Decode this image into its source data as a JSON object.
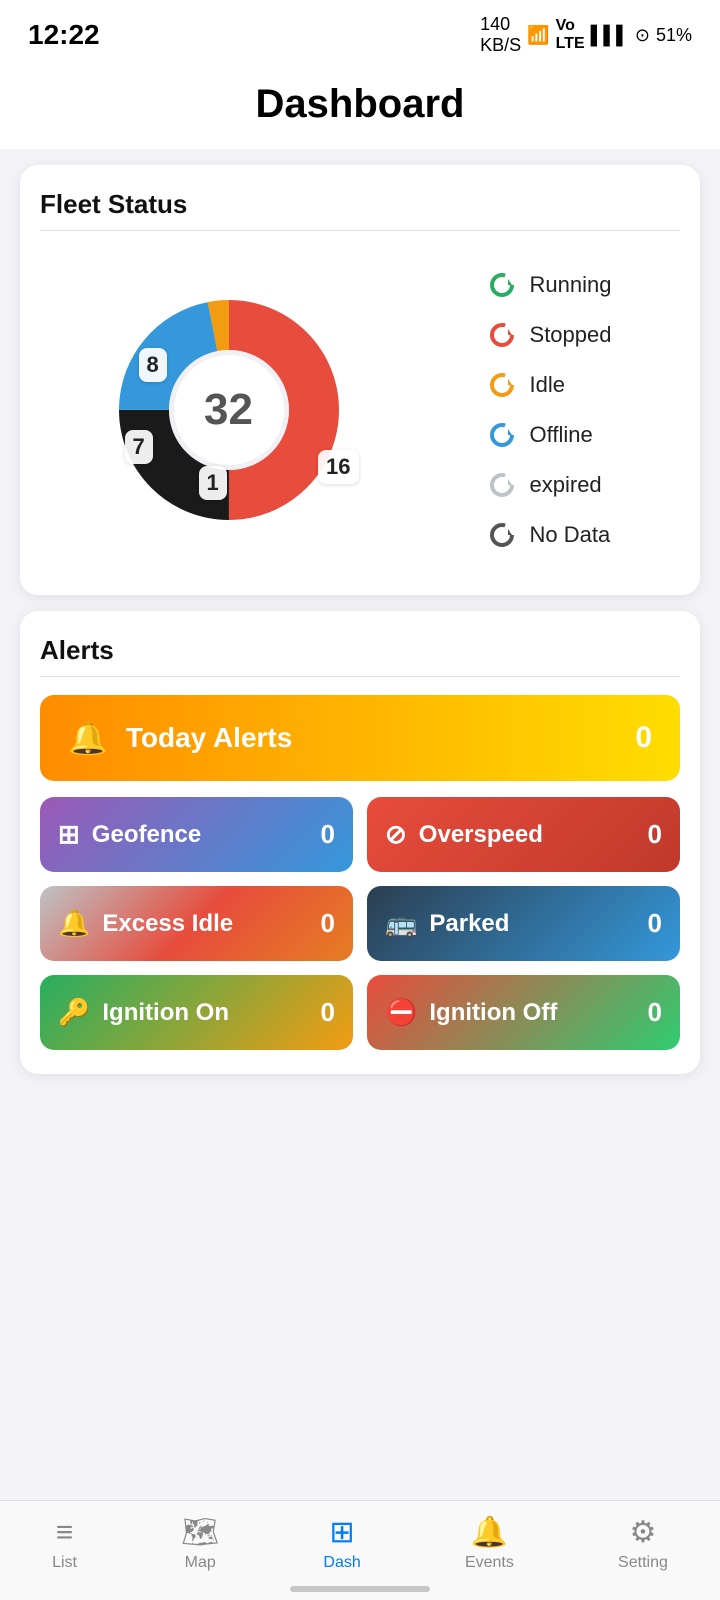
{
  "statusBar": {
    "time": "12:22",
    "battery": "51%",
    "signal": "140 KB/S"
  },
  "header": {
    "title": "Dashboard"
  },
  "fleetStatus": {
    "title": "Fleet Status",
    "total": "32",
    "segments": [
      {
        "label": "Running",
        "value": 16,
        "color": "#e74c3c"
      },
      {
        "label": "Stopped",
        "value": 8,
        "color": "#1a1a1a"
      },
      {
        "label": "Idle",
        "value": 1,
        "color": "#f39c12"
      },
      {
        "label": "Offline",
        "value": 7,
        "color": "#3498db"
      },
      {
        "label": "expired",
        "value": 0,
        "color": "#bdc3c7"
      },
      {
        "label": "No Data",
        "value": 0,
        "color": "#555"
      }
    ],
    "badges": [
      {
        "id": "8",
        "class": "badge-8"
      },
      {
        "id": "16",
        "class": "badge-16"
      },
      {
        "id": "7",
        "class": "badge-7"
      },
      {
        "id": "1",
        "class": "badge-1"
      }
    ]
  },
  "alerts": {
    "title": "Alerts",
    "todayAlertsLabel": "Today Alerts",
    "todayCount": "0",
    "items": [
      {
        "id": "geofence",
        "label": "Geofence",
        "count": "0",
        "icon": "⊞",
        "class": "btn-geofence"
      },
      {
        "id": "overspeed",
        "label": "Overspeed",
        "count": "0",
        "icon": "⊘",
        "class": "btn-overspeed"
      },
      {
        "id": "excess-idle",
        "label": "Excess Idle",
        "count": "0",
        "icon": "🔔",
        "class": "btn-excess-idle"
      },
      {
        "id": "parked",
        "label": "Parked",
        "count": "0",
        "icon": "🚌",
        "class": "btn-parked"
      },
      {
        "id": "ignition-on",
        "label": "Ignition On",
        "count": "0",
        "icon": "🔑",
        "class": "btn-ignition-on"
      },
      {
        "id": "ignition-off",
        "label": "Ignition Off",
        "count": "0",
        "icon": "⛔",
        "class": "btn-ignition-off"
      }
    ]
  },
  "nav": {
    "items": [
      {
        "id": "list",
        "label": "List",
        "icon": "≡",
        "active": false
      },
      {
        "id": "map",
        "label": "Map",
        "icon": "🗺",
        "active": false
      },
      {
        "id": "dash",
        "label": "Dash",
        "icon": "⊞",
        "active": true
      },
      {
        "id": "events",
        "label": "Events",
        "icon": "🔔",
        "active": false
      },
      {
        "id": "setting",
        "label": "Setting",
        "icon": "⚙",
        "active": false
      }
    ]
  }
}
